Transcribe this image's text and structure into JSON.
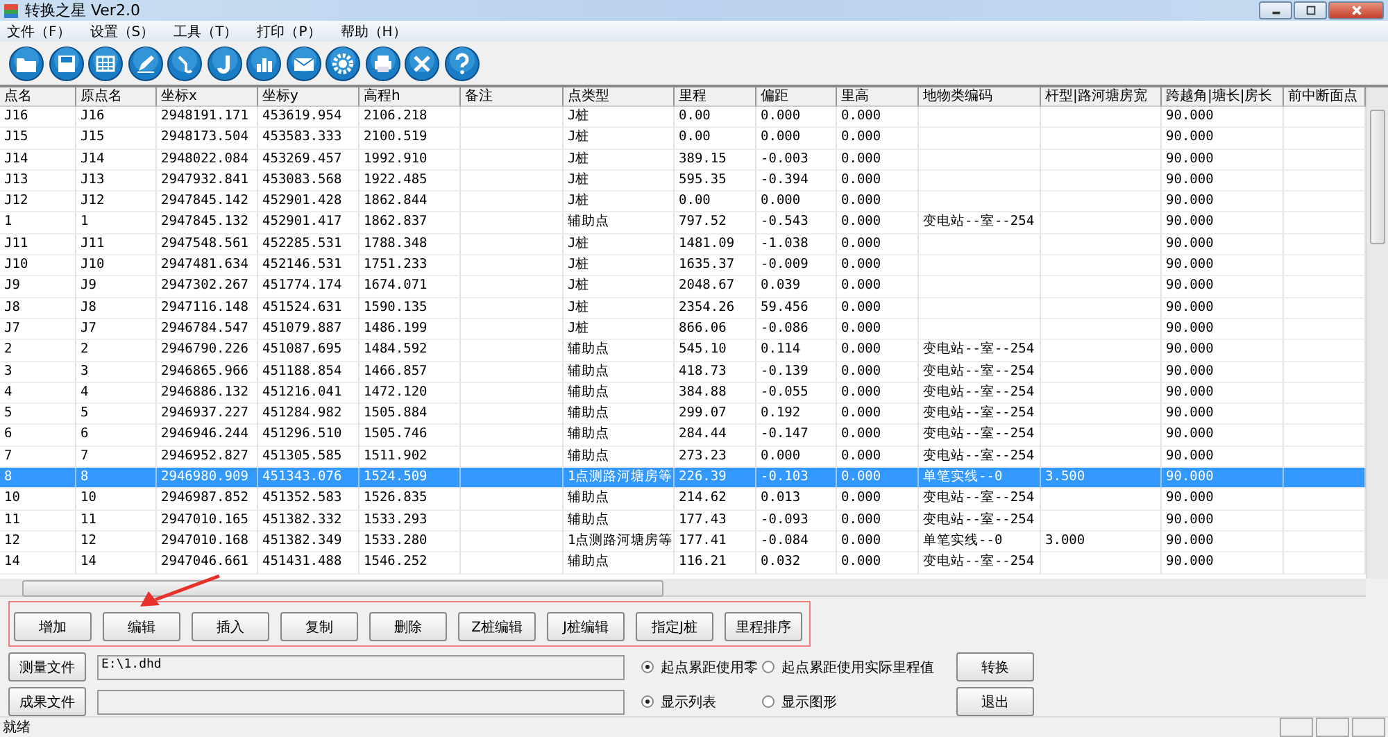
{
  "window": {
    "title": "转换之星 Ver2.0"
  },
  "menu": [
    {
      "label": "文件（F）"
    },
    {
      "label": "设置（S）"
    },
    {
      "label": "工具（T）"
    },
    {
      "label": "打印（P）"
    },
    {
      "label": "帮助（H）"
    }
  ],
  "table": {
    "columns": [
      "点名",
      "原点名",
      "坐标x",
      "坐标y",
      "高程h",
      "备注",
      "点类型",
      "里程",
      "偏距",
      "里高",
      "地物类编码",
      "杆型|路河塘房宽",
      "跨越角|塘长|房长",
      "前中断面点"
    ],
    "rows": [
      {
        "cells": [
          "J16",
          "J16",
          "2948191.171",
          "453619.954",
          "2106.218",
          "",
          "J桩",
          "0.00",
          "0.000",
          "0.000",
          "",
          "",
          "90.000",
          ""
        ],
        "selected": false
      },
      {
        "cells": [
          "J15",
          "J15",
          "2948173.504",
          "453583.333",
          "2100.519",
          "",
          "J桩",
          "0.00",
          "0.000",
          "0.000",
          "",
          "",
          "90.000",
          ""
        ],
        "selected": false
      },
      {
        "cells": [
          "J14",
          "J14",
          "2948022.084",
          "453269.457",
          "1992.910",
          "",
          "J桩",
          "389.15",
          "-0.003",
          "0.000",
          "",
          "",
          "90.000",
          ""
        ],
        "selected": false
      },
      {
        "cells": [
          "J13",
          "J13",
          "2947932.841",
          "453083.568",
          "1922.485",
          "",
          "J桩",
          "595.35",
          "-0.394",
          "0.000",
          "",
          "",
          "90.000",
          ""
        ],
        "selected": false
      },
      {
        "cells": [
          "J12",
          "J12",
          "2947845.142",
          "452901.428",
          "1862.844",
          "",
          "J桩",
          "0.00",
          "0.000",
          "0.000",
          "",
          "",
          "90.000",
          ""
        ],
        "selected": false
      },
      {
        "cells": [
          "1",
          "1",
          "2947845.132",
          "452901.417",
          "1862.837",
          "",
          "辅助点",
          "797.52",
          "-0.543",
          "0.000",
          "变电站--室--254",
          "",
          "90.000",
          ""
        ],
        "selected": false
      },
      {
        "cells": [
          "J11",
          "J11",
          "2947548.561",
          "452285.531",
          "1788.348",
          "",
          "J桩",
          "1481.09",
          "-1.038",
          "0.000",
          "",
          "",
          "90.000",
          ""
        ],
        "selected": false
      },
      {
        "cells": [
          "J10",
          "J10",
          "2947481.634",
          "452146.531",
          "1751.233",
          "",
          "J桩",
          "1635.37",
          "-0.009",
          "0.000",
          "",
          "",
          "90.000",
          ""
        ],
        "selected": false
      },
      {
        "cells": [
          "J9",
          "J9",
          "2947302.267",
          "451774.174",
          "1674.071",
          "",
          "J桩",
          "2048.67",
          "0.039",
          "0.000",
          "",
          "",
          "90.000",
          ""
        ],
        "selected": false
      },
      {
        "cells": [
          "J8",
          "J8",
          "2947116.148",
          "451524.631",
          "1590.135",
          "",
          "J桩",
          "2354.26",
          "59.456",
          "0.000",
          "",
          "",
          "90.000",
          ""
        ],
        "selected": false
      },
      {
        "cells": [
          "J7",
          "J7",
          "2946784.547",
          "451079.887",
          "1486.199",
          "",
          "J桩",
          "866.06",
          "-0.086",
          "0.000",
          "",
          "",
          "90.000",
          ""
        ],
        "selected": false
      },
      {
        "cells": [
          "2",
          "2",
          "2946790.226",
          "451087.695",
          "1484.592",
          "",
          "辅助点",
          "545.10",
          "0.114",
          "0.000",
          "变电站--室--254",
          "",
          "90.000",
          ""
        ],
        "selected": false
      },
      {
        "cells": [
          "3",
          "3",
          "2946865.966",
          "451188.854",
          "1466.857",
          "",
          "辅助点",
          "418.73",
          "-0.139",
          "0.000",
          "变电站--室--254",
          "",
          "90.000",
          ""
        ],
        "selected": false
      },
      {
        "cells": [
          "4",
          "4",
          "2946886.132",
          "451216.041",
          "1472.120",
          "",
          "辅助点",
          "384.88",
          "-0.055",
          "0.000",
          "变电站--室--254",
          "",
          "90.000",
          ""
        ],
        "selected": false
      },
      {
        "cells": [
          "5",
          "5",
          "2946937.227",
          "451284.982",
          "1505.884",
          "",
          "辅助点",
          "299.07",
          "0.192",
          "0.000",
          "变电站--室--254",
          "",
          "90.000",
          ""
        ],
        "selected": false
      },
      {
        "cells": [
          "6",
          "6",
          "2946946.244",
          "451296.510",
          "1505.746",
          "",
          "辅助点",
          "284.44",
          "-0.147",
          "0.000",
          "变电站--室--254",
          "",
          "90.000",
          ""
        ],
        "selected": false
      },
      {
        "cells": [
          "7",
          "7",
          "2946952.827",
          "451305.585",
          "1511.902",
          "",
          "辅助点",
          "273.23",
          "0.000",
          "0.000",
          "变电站--室--254",
          "",
          "90.000",
          ""
        ],
        "selected": false
      },
      {
        "cells": [
          "8",
          "8",
          "2946980.909",
          "451343.076",
          "1524.509",
          "",
          "1点测路河塘房等",
          "226.39",
          "-0.103",
          "0.000",
          "单笔实线--0",
          "3.500",
          "90.000",
          ""
        ],
        "selected": true
      },
      {
        "cells": [
          "10",
          "10",
          "2946987.852",
          "451352.583",
          "1526.835",
          "",
          "辅助点",
          "214.62",
          "0.013",
          "0.000",
          "变电站--室--254",
          "",
          "90.000",
          ""
        ],
        "selected": false
      },
      {
        "cells": [
          "11",
          "11",
          "2947010.165",
          "451382.332",
          "1533.293",
          "",
          "辅助点",
          "177.43",
          "-0.093",
          "0.000",
          "变电站--室--254",
          "",
          "90.000",
          ""
        ],
        "selected": false
      },
      {
        "cells": [
          "12",
          "12",
          "2947010.168",
          "451382.349",
          "1533.280",
          "",
          "1点测路河塘房等",
          "177.41",
          "-0.084",
          "0.000",
          "单笔实线--0",
          "3.000",
          "90.000",
          ""
        ],
        "selected": false
      },
      {
        "cells": [
          "14",
          "14",
          "2947046.661",
          "451431.488",
          "1546.252",
          "",
          "辅助点",
          "116.21",
          "0.032",
          "0.000",
          "变电站--室--254",
          "",
          "90.000",
          ""
        ],
        "selected": false
      }
    ]
  },
  "action_buttons": [
    "增加",
    "编辑",
    "插入",
    "复制",
    "删除",
    "Z桩编辑",
    "J桩编辑",
    "指定J桩",
    "里程排序"
  ],
  "annotation": {
    "highlight": true,
    "arrow": true
  },
  "file_rows": [
    {
      "button": "测量文件",
      "path": "E:\\1.dhd",
      "options": [
        {
          "label": "起点累距使用零",
          "selected": true
        },
        {
          "label": "起点累距使用实际里程值",
          "selected": false
        }
      ],
      "command": "转换"
    },
    {
      "button": "成果文件",
      "options": [
        {
          "label": "显示列表",
          "selected": true
        },
        {
          "label": "显示图形",
          "selected": false
        }
      ],
      "command": "退出"
    }
  ],
  "status_bar": {
    "text": "就绪"
  }
}
